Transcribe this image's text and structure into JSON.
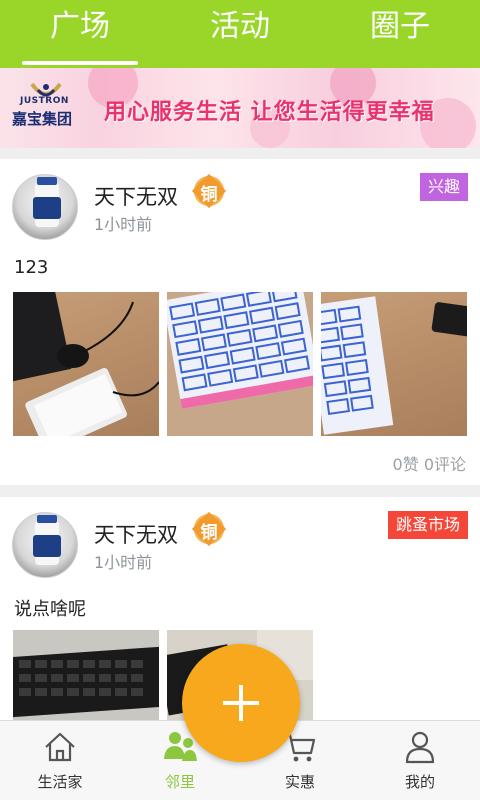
{
  "top_tabs": [
    {
      "label": "广场",
      "active": true
    },
    {
      "label": "活动",
      "active": false
    },
    {
      "label": "圈子",
      "active": false
    }
  ],
  "banner": {
    "logo_en": "JUSTRON",
    "logo_cn": "嘉宝集团",
    "slogan": "用心服务生活  让您生活得更幸福"
  },
  "posts": [
    {
      "username": "天下无双",
      "medal": "铜",
      "time": "1小时前",
      "tag": "兴趣",
      "tag_color": "#c064e0",
      "text": "123",
      "counts": "0赞 0评论"
    },
    {
      "username": "天下无双",
      "medal": "铜",
      "time": "1小时前",
      "tag": "跳蚤市场",
      "tag_color": "#f4473a",
      "text": "说点啥呢"
    }
  ],
  "fab": {
    "icon": "plus-icon"
  },
  "bottom_nav": [
    {
      "label": "生活家",
      "icon": "home-icon",
      "active": false
    },
    {
      "label": "邻里",
      "icon": "people-icon",
      "active": true
    },
    {
      "label": "实惠",
      "icon": "cart-icon",
      "active": false
    },
    {
      "label": "我的",
      "icon": "user-icon",
      "active": false
    }
  ],
  "colors": {
    "topbar": "#9ad62a",
    "active_nav": "#8cc73f",
    "fab": "#f8a81c",
    "slogan": "#e8336f"
  }
}
